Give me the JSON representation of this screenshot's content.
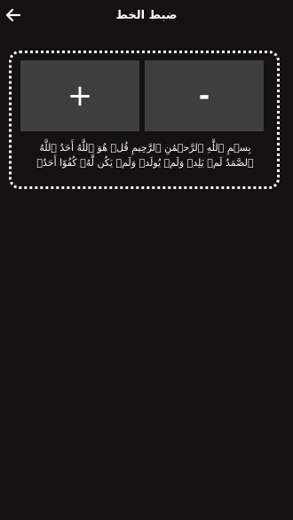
{
  "header": {
    "title": "ضبط الخط",
    "back_icon": "arrow-left-icon"
  },
  "font_controls": {
    "increase_label": "+",
    "decrease_label": "-",
    "preview_text": "بِسۡمِ ٱللَّهِ ٱلرَّحۡمَٰنِ ٱلرَّحِيمِ قُلۡ هُوَ ٱللَّهُ أَحَدٌ ٱللَّهُ ٱلصَّمَدُ لَمۡ يَلِدۡ وَلَمۡ يُولَدۡ وَلَمۡ يَكُن لَّهُۥ كُفُوًا أَحَدُۢ"
  },
  "colors": {
    "background": "#141112",
    "button": "#3e3e3e",
    "text": "#ffffff"
  }
}
